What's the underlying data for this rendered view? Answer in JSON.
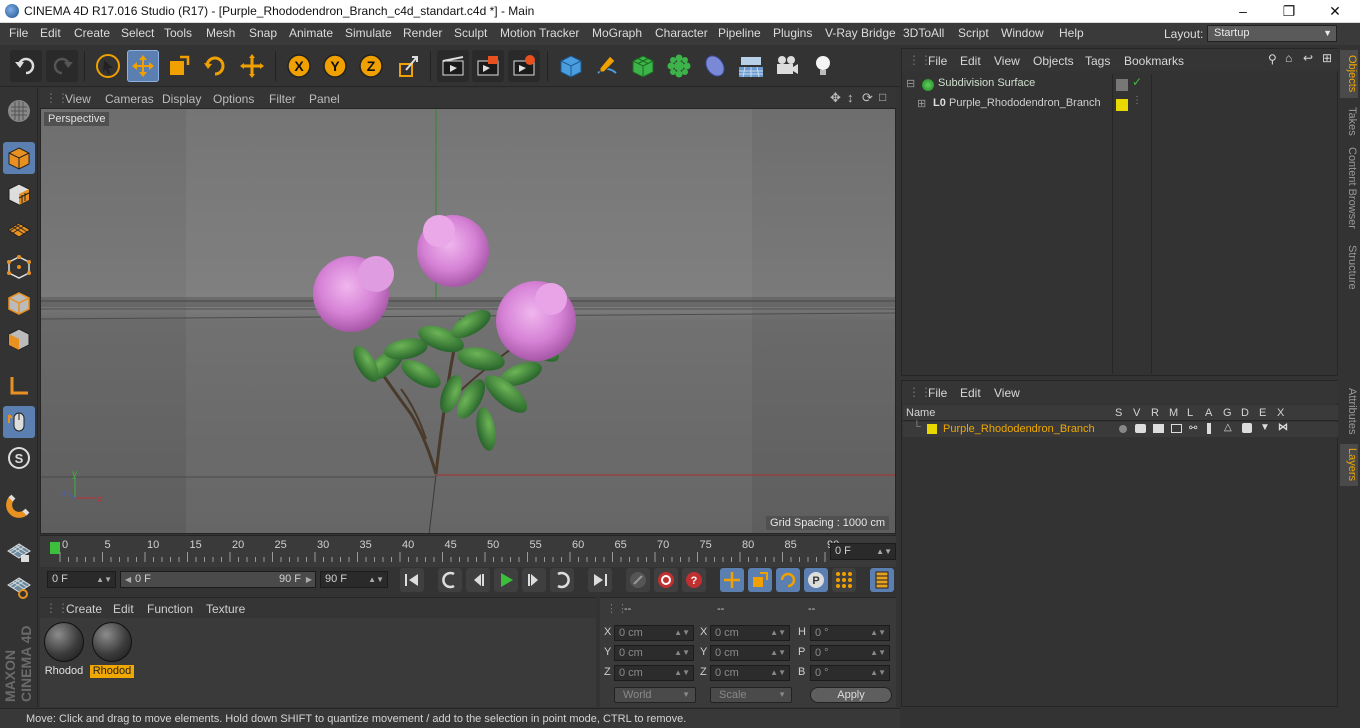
{
  "window": {
    "title": "CINEMA 4D R17.016 Studio (R17) - [Purple_Rhododendron_Branch_c4d_standart.c4d *] - Main",
    "minimize": "–",
    "maximize": "❐",
    "close": "✕"
  },
  "menubar": {
    "items": [
      "File",
      "Edit",
      "Create",
      "Select",
      "Tools",
      "Mesh",
      "Snap",
      "Animate",
      "Simulate",
      "Render",
      "Sculpt",
      "Motion Tracker",
      "MoGraph",
      "Character",
      "Pipeline",
      "Plugins",
      "V-Ray Bridge",
      "3DToAll",
      "Script",
      "Window",
      "Help"
    ],
    "layout_label": "Layout:",
    "layout_value": "Startup"
  },
  "toolbar": {
    "icons": [
      "undo-icon",
      "redo-icon",
      "select-cursor-icon",
      "move-icon",
      "scale-icon",
      "rotate-icon",
      "live-selection-icon",
      "x-axis-icon",
      "y-axis-icon",
      "z-axis-icon",
      "coordinate-system-icon",
      "render-view-icon",
      "render-picture-viewer-icon",
      "edit-render-settings-icon",
      "cube-icon",
      "pen-icon",
      "subdivision-icon",
      "cloner-icon",
      "deformer-icon",
      "floor-icon",
      "camera-icon",
      "light-icon"
    ],
    "x": "X",
    "y": "Y",
    "z": "Z"
  },
  "viewport": {
    "menu": [
      "View",
      "Cameras",
      "Display",
      "Options",
      "Filter",
      "Panel"
    ],
    "camera": "Perspective",
    "grid_spacing": "Grid Spacing : 1000 cm",
    "axis_x": "x",
    "axis_y": "y",
    "axis_z": "z"
  },
  "timeline": {
    "ticks": [
      "0",
      "5",
      "10",
      "15",
      "20",
      "25",
      "30",
      "35",
      "40",
      "45",
      "50",
      "55",
      "60",
      "65",
      "70",
      "75",
      "80",
      "85",
      "90"
    ],
    "current_frame_field": "0 F"
  },
  "transport": {
    "start_field": "0 F",
    "range_start": "0 F",
    "range_end": "90 F",
    "end_field": "90 F"
  },
  "materials": {
    "menu": [
      "Create",
      "Edit",
      "Function",
      "Texture"
    ],
    "items": [
      {
        "name": "Rhodod",
        "selected": false
      },
      {
        "name": "Rhodod",
        "selected": true
      }
    ]
  },
  "coordinates": {
    "headers": [
      "--",
      "--",
      "--"
    ],
    "rows": [
      {
        "l1": "X",
        "v1": "0 cm",
        "l2": "X",
        "v2": "0 cm",
        "l3": "H",
        "v3": "0 °"
      },
      {
        "l1": "Y",
        "v1": "0 cm",
        "l2": "Y",
        "v2": "0 cm",
        "l3": "P",
        "v3": "0 °"
      },
      {
        "l1": "Z",
        "v1": "0 cm",
        "l2": "Z",
        "v2": "0 cm",
        "l3": "B",
        "v3": "0 °"
      }
    ],
    "space": "World",
    "mode": "Scale",
    "apply": "Apply"
  },
  "object_manager": {
    "menu": [
      "File",
      "Edit",
      "View",
      "Objects",
      "Tags",
      "Bookmarks"
    ],
    "objects": [
      {
        "name": "Subdivision Surface",
        "expanded": true
      },
      {
        "name": "Purple_Rhododendron_Branch",
        "expanded": false
      }
    ]
  },
  "layer_manager": {
    "menu": [
      "File",
      "Edit",
      "View"
    ],
    "columns": [
      "Name",
      "S",
      "V",
      "R",
      "M",
      "L",
      "A",
      "G",
      "D",
      "E",
      "X"
    ],
    "layers": [
      {
        "name": "Purple_Rhododendron_Branch",
        "color": "#e8d800"
      }
    ]
  },
  "right_tabs": [
    "Objects",
    "Takes",
    "Content Browser",
    "Structure",
    "Attributes",
    "Layers"
  ],
  "brand": "MAXON CINEMA 4D",
  "status": "Move: Click and drag to move elements. Hold down SHIFT to quantize movement / add to the selection in point mode, CTRL to remove.",
  "colors": {
    "accent_blue": "#5a7fb0",
    "selection_orange": "#f0a800",
    "layer_yellow": "#e8d800"
  }
}
